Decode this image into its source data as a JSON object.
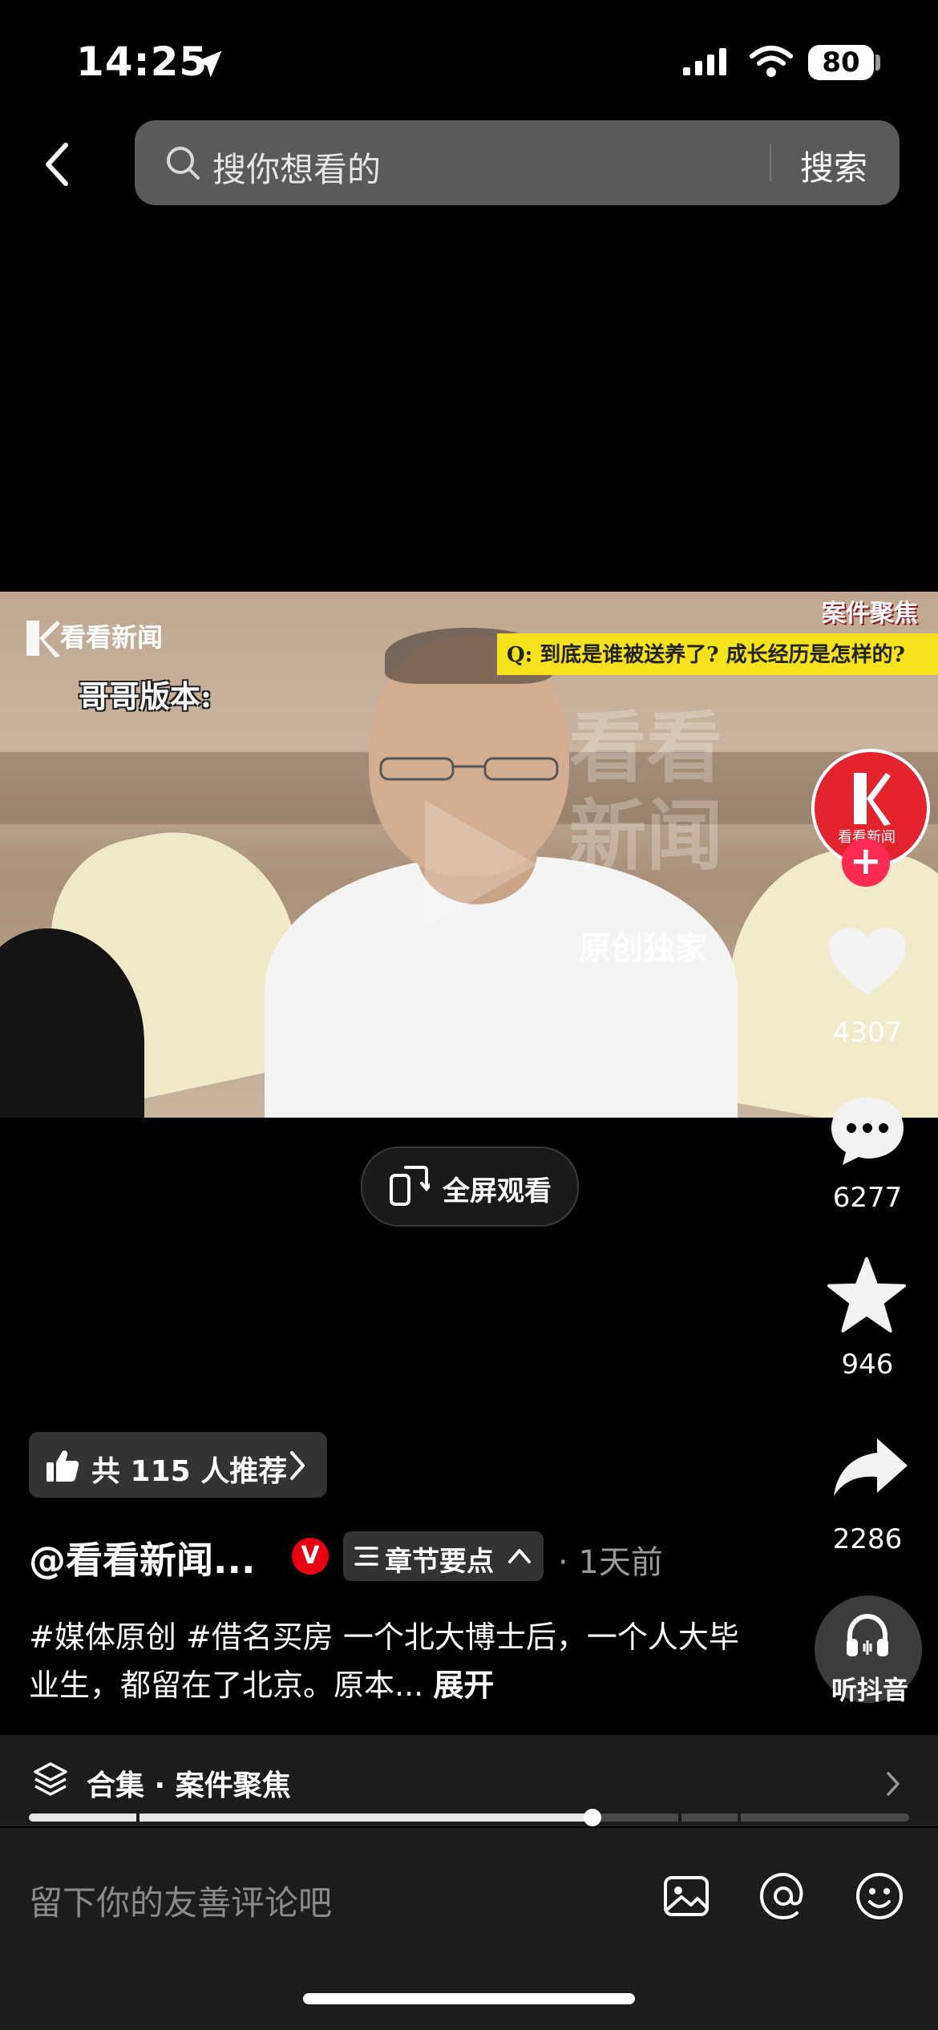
{
  "status_bar": {
    "time": "14:25",
    "battery": "80"
  },
  "header": {
    "search_placeholder": "搜你想看的",
    "search_button": "搜索"
  },
  "video": {
    "brand": "看看新闻",
    "caption_left": "哥哥版本:",
    "question": "Q: 到底是谁被送养了? 成长经历是怎样的?",
    "corner_tag": "案件聚焦",
    "watermark_line1": "看看",
    "watermark_line2": "新闻",
    "watermark_original": "原创独家"
  },
  "actions": {
    "avatar_label": "看看新闻",
    "likes": "4307",
    "comments": "6277",
    "favorites": "946",
    "shares": "2286",
    "listen_label": "听抖音"
  },
  "fullscreen_label": "全屏观看",
  "recommend_label": "共 115 人推荐",
  "author": {
    "name": "@看看新闻...",
    "badge": "V",
    "chapter_label": "章节要点",
    "time_ago": "· 1天前"
  },
  "description": {
    "text": "#媒体原创 #借名买房 一个北大博士后，一个人大毕业生，都留在了北京。原本...",
    "more": "展开"
  },
  "collection": {
    "label": "合集 · 案件聚焦"
  },
  "playback_progress": 0.64,
  "comment_bar": {
    "placeholder": "留下你的友善评论吧"
  },
  "colors": {
    "accent_red": "#fe2c55",
    "brand_red": "#e3232e",
    "caption_yellow": "#f4e21a"
  }
}
